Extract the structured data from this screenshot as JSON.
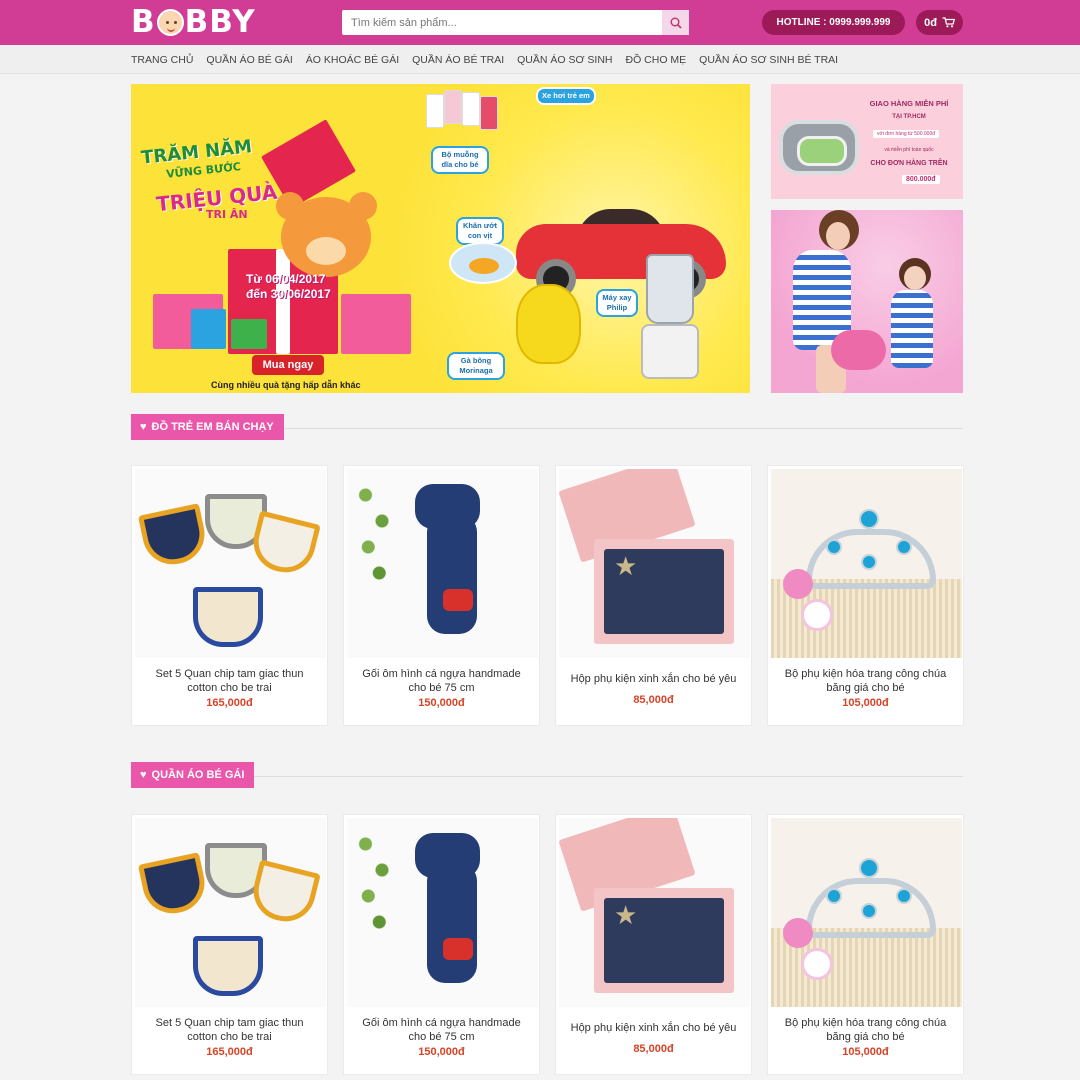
{
  "header": {
    "logo": "B BBY",
    "search_placeholder": "Tìm kiếm sản phẩm...",
    "hotline": "HOTLINE : 0999.999.999",
    "cart_total": "0đ"
  },
  "nav": [
    "TRANG CHỦ",
    "QUẦN ÁO BÉ GÁI",
    "ÁO KHOÁC BÉ GÁI",
    "QUẦN ÁO BÉ TRAI",
    "QUẦN ÁO SƠ SINH",
    "ĐỒ CHO MẸ",
    "QUẦN ÁO SƠ SINH BÉ TRAI"
  ],
  "banner_main": {
    "line1": "TRĂM NĂM",
    "line2": "VỮNG BƯỚC",
    "line3": "TRIỆU QUÀ",
    "line4": "TRI ÂN",
    "date1": "Từ 06/04/2017",
    "date2": "đến 30/06/2017",
    "cta": "Mua ngay",
    "sub": "Cùng nhiều quà tặng hấp dẫn khác",
    "tag_car": "Xe hơi trẻ em",
    "tag_spoon": "Bộ muỗng dĩa cho bé",
    "tag_towel": "Khăn ướt con vịt",
    "tag_blender": "Máy xay Philip",
    "tag_chick": "Gà bông Morinaga"
  },
  "banner_r1": {
    "title": "GIAO HÀNG MIỄN PHÍ",
    "sub": "TẠI TP.HCM",
    "note1": "với đơn hàng từ 500.000đ",
    "note2": "và miễn phí toàn quốc",
    "line": "CHO ĐƠN HÀNG TRÊN",
    "price": "800.000đ"
  },
  "sections": [
    {
      "title": "ĐỒ TRẺ EM BÁN CHẠY",
      "products": [
        {
          "name": "Set 5 Quan chip tam giac thun cotton cho be trai",
          "price": "165,000đ"
        },
        {
          "name": "Gối ôm hình cá ngựa handmade cho bé 75 cm",
          "price": "150,000đ"
        },
        {
          "name": "Hộp phụ kiện xinh xắn cho bé yêu",
          "price": "85,000đ"
        },
        {
          "name": "Bộ phụ kiện hóa trang công chúa băng giá cho bé",
          "price": "105,000đ"
        }
      ]
    },
    {
      "title": "QUẦN ÁO BÉ GÁI",
      "products": [
        {
          "name": "Set 5 Quan chip tam giac thun cotton cho be trai",
          "price": "165,000đ"
        },
        {
          "name": "Gối ôm hình cá ngựa handmade cho bé 75 cm",
          "price": "150,000đ"
        },
        {
          "name": "Hộp phụ kiện xinh xắn cho bé yêu",
          "price": "85,000đ"
        },
        {
          "name": "Bộ phụ kiện hóa trang công chúa băng giá cho bé",
          "price": "105,000đ"
        }
      ]
    }
  ],
  "colors": {
    "brand": "#d13c95",
    "dark": "#9c1a57",
    "accent": "#ea57aa",
    "price": "#d64326"
  },
  "icons": [
    "search-icon",
    "cart-icon",
    "heart-icon"
  ]
}
